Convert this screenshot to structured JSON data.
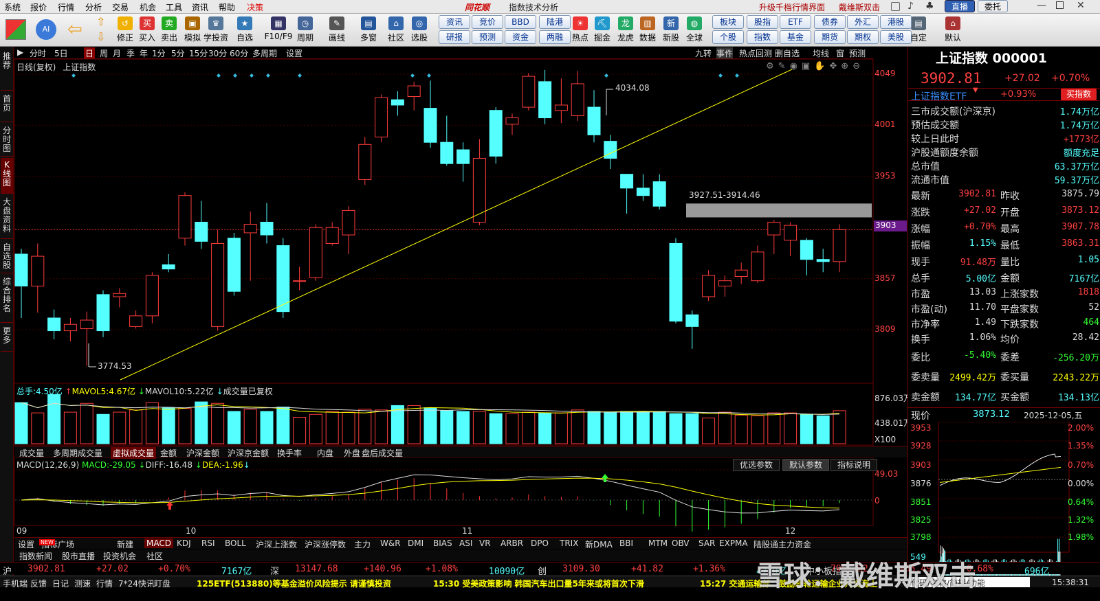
{
  "menu": [
    "系统",
    "报价",
    "行情",
    "分析",
    "交易",
    "机会",
    "工具",
    "资讯",
    "帮助",
    "决策"
  ],
  "brand": "同花顺",
  "window_title": "指数技术分析",
  "header_links": [
    "升级千档行情界面",
    "戴维斯双击"
  ],
  "header_buttons": [
    "直播",
    "委托"
  ],
  "toolbar": [
    "修正",
    "买入",
    "卖出",
    "模拟",
    "学投资",
    "自选",
    "F10/F9",
    "周期",
    "画线",
    "多窗",
    "社区",
    "选股",
    "热点",
    "掘金",
    "龙虎",
    "数据",
    "新股",
    "全球",
    "自定",
    "默认"
  ],
  "quick_top": [
    "资讯",
    "竞价",
    "BBD",
    "陆港",
    "板块",
    "股指",
    "ETF",
    "债券",
    "外汇",
    "港股"
  ],
  "quick_bot": [
    "研报",
    "预测",
    "资金",
    "两融",
    "个股",
    "指数",
    "基金",
    "期货",
    "期权",
    "美股"
  ],
  "left_tabs": [
    "推荐",
    "首页",
    "分时图",
    "K线图",
    "大盘资料",
    "自选股",
    "综合排名",
    "更多"
  ],
  "timeframes": [
    "分时",
    "5日",
    "日",
    "周",
    "月",
    "季",
    "年",
    "1分",
    "5分",
    "15分",
    "30分",
    "60分",
    "多周期",
    "设置"
  ],
  "tf_right": [
    "九转",
    "事件",
    "热点回测",
    "删自选",
    "均线",
    "窗",
    "预测"
  ],
  "chart_header": {
    "mode": "日线(复权)",
    "name": "上证指数"
  },
  "price_axis": [
    "4049",
    "4001",
    "3953",
    "3903",
    "3857",
    "3809"
  ],
  "current_price_tag": "3903",
  "annotations": {
    "high": "4034.08",
    "low": "3774.53",
    "gap": "3927.51-3914.46"
  },
  "volume": {
    "label": "总手:",
    "total": "4.50亿",
    "mavol5_label": "MAVOL5:",
    "mavol5": "4.67亿",
    "mavol10_label": "MAVOL10:",
    "mavol10": "5.22亿",
    "note": "成交量已复权",
    "axis": [
      "876.03万",
      "438.01万",
      "X100"
    ]
  },
  "vol_tabs": [
    "成交量",
    "多周期成交量",
    "虚拟成交量",
    "金额",
    "沪深金额",
    "沪深京金额",
    "换手率",
    "内盘",
    "外盘",
    "盘后成交量"
  ],
  "macd": {
    "title": "MACD(12,26,9)",
    "macd_label": "MACD:",
    "macd": "-29.05",
    "diff_label": "DIFF:",
    "diff": "-16.48",
    "dea_label": "DEA:",
    "dea": "-1.96",
    "axis": [
      "49.03",
      "0"
    ],
    "buttons": [
      "优选参数",
      "默认参数",
      "指标说明"
    ]
  },
  "x_axis": [
    "09",
    "10",
    "11",
    "12"
  ],
  "ind_tabs": [
    "设置",
    "指标广场",
    "新建",
    "MACD",
    "KDJ",
    "RSI",
    "BOLL",
    "沪深上涨数",
    "沪深涨停数",
    "主力",
    "W&R",
    "DMI",
    "BIAS",
    "ASI",
    "VR",
    "ARBR",
    "DPO",
    "TRIX",
    "新DMA",
    "BBI",
    "MTM",
    "OBV",
    "SAR",
    "EXPMA",
    "陆股通主力资金"
  ],
  "ind_tabs2": [
    "指数新闻",
    "股市直播",
    "投资机会",
    "社区"
  ],
  "quote": {
    "title": "上证指数",
    "code": "000001",
    "price": "3902.81",
    "change": "+27.02",
    "pct": "+0.70%",
    "etf": "上证指数ETF",
    "etf_pct": "+0.93%",
    "buy_btn": "买指数"
  },
  "stats1": [
    [
      "三市成交额(沪深京)",
      "1.74万亿"
    ],
    [
      "预估成交额",
      "1.74万亿"
    ],
    [
      "较上日此时",
      "+1773亿"
    ],
    [
      "沪股通额度余额",
      "额度充足"
    ],
    [
      "总市值",
      "63.37万亿"
    ],
    [
      "流通市值",
      "59.37万亿"
    ]
  ],
  "stats2": [
    [
      "最新",
      "3902.81",
      "昨收",
      "3875.79"
    ],
    [
      "涨跌",
      "+27.02",
      "开盘",
      "3873.12"
    ],
    [
      "涨幅",
      "+0.70%",
      "最高",
      "3907.78"
    ],
    [
      "振幅",
      "1.15%",
      "最低",
      "3863.31"
    ],
    [
      "现手",
      "91.48万",
      "量比",
      "1.05"
    ],
    [
      "总手",
      "5.00亿",
      "金额",
      "7167亿"
    ]
  ],
  "stats3": [
    [
      "市盈",
      "13.03",
      "上涨家数",
      "1818"
    ],
    [
      "市盈(动)",
      "11.70",
      "平盘家数",
      "52"
    ],
    [
      "市净率",
      "1.49",
      "下跌家数",
      "464"
    ],
    [
      "换手",
      "1.06%",
      "均价",
      "28.42"
    ]
  ],
  "stats4": [
    [
      "委比",
      "-5.40%",
      "委差",
      "-256.20万"
    ],
    [
      "委卖量",
      "2499.42万",
      "委买量",
      "2243.22万"
    ],
    [
      "卖金额",
      "134.77亿",
      "买金额",
      "134.13亿"
    ]
  ],
  "mini": {
    "label": "现价",
    "price": "3873.12",
    "date": "2025-12-05,五",
    "left_axis": [
      "3953",
      "3928",
      "3903",
      "3876",
      "3851",
      "3825",
      "3798",
      "549"
    ],
    "right_axis": [
      "2.00%",
      "1.35%",
      "0.70%",
      "0.00%",
      "0.64%",
      "1.32%",
      "1.98%"
    ]
  },
  "quotes_bar": [
    [
      "沪",
      "3902.81",
      "+27.02",
      "+0.70%",
      "7167亿"
    ],
    [
      "深",
      "13147.68",
      "+140.96",
      "+1.08%",
      "10090亿"
    ],
    [
      "创",
      "3109.30",
      "+41.82",
      "+1.36%",
      "4770亿"
    ],
    [
      "中小板指",
      "7957.82",
      "+53.49",
      "+0.68%",
      "696亿"
    ]
  ],
  "status": {
    "tabs": [
      "手机端",
      "反馈",
      "日记",
      "测速",
      "行情",
      "7*24快讯",
      "盯盘"
    ],
    "news1": "125ETF(513880)等基金溢价风险提示 请谨慎投资",
    "news2": "15:30 受美政策影响 韩国汽车出口量5年来或将首次下滑",
    "news3": "15:27 交通运输部：鼓励邮轮运输企业开发海上",
    "search": "代码/名称/简拼/功能",
    "time": "15:38:31"
  },
  "watermark": "雪球：戴维斯双击",
  "candles": [
    [
      3880,
      3850,
      3885,
      3820
    ],
    [
      3850,
      3878,
      3890,
      3825
    ],
    [
      3820,
      3808,
      3828,
      3800
    ],
    [
      3808,
      3814,
      3820,
      3798
    ],
    [
      3810,
      3818,
      3826,
      3775
    ],
    [
      3842,
      3808,
      3846,
      3802
    ],
    [
      3840,
      3843,
      3848,
      3830
    ],
    [
      3812,
      3822,
      3827,
      3810
    ],
    [
      3822,
      3860,
      3863,
      3815
    ],
    [
      3870,
      3866,
      3880,
      3863
    ],
    [
      3895,
      3935,
      3938,
      3888
    ],
    [
      3910,
      3892,
      3930,
      3885
    ],
    [
      3812,
      3890,
      3903,
      3808
    ],
    [
      3895,
      3845,
      3900,
      3841
    ],
    [
      3900,
      3908,
      3920,
      3855
    ],
    [
      3910,
      3898,
      3928,
      3890
    ],
    [
      3888,
      3826,
      3895,
      3820
    ],
    [
      3855,
      3855,
      3868,
      3846
    ],
    [
      3858,
      3905,
      3908,
      3855
    ],
    [
      3890,
      3905,
      3910,
      3888
    ],
    [
      3898,
      3921,
      3925,
      3880
    ],
    [
      3950,
      3983,
      3990,
      3945
    ],
    [
      3990,
      4027,
      4030,
      3985
    ],
    [
      4025,
      4020,
      4033,
      4010
    ],
    [
      4028,
      4038,
      4042,
      4015
    ],
    [
      4017,
      3985,
      4043,
      3980
    ],
    [
      3985,
      3965,
      4010,
      3963
    ],
    [
      3978,
      3965,
      3985,
      3948
    ],
    [
      3910,
      3970,
      3988,
      3907
    ],
    [
      4015,
      3972,
      4018,
      3965
    ],
    [
      4002,
      4008,
      4012,
      3992
    ],
    [
      4018,
      4047,
      4050,
      4015
    ],
    [
      4042,
      4008,
      4053,
      4002
    ],
    [
      4015,
      4020,
      4045,
      4003
    ],
    [
      4010,
      4040,
      4052,
      4005
    ],
    [
      4018,
      3992,
      4034,
      3985
    ],
    [
      3986,
      3970,
      3992,
      3960
    ],
    [
      3955,
      3942,
      3955,
      3918
    ],
    [
      3942,
      3935,
      3955,
      3930
    ],
    [
      3948,
      3925,
      3955,
      3922
    ],
    [
      3890,
      3817,
      3895,
      3815
    ],
    [
      3823,
      3812,
      3827,
      3791
    ],
    [
      3840,
      3860,
      3865,
      3836
    ],
    [
      3850,
      3855,
      3860,
      3840
    ],
    [
      3859,
      3865,
      3872,
      3852
    ],
    [
      3855,
      3882,
      3888,
      3853
    ],
    [
      3898,
      3910,
      3912,
      3880
    ],
    [
      3893,
      3907,
      3910,
      3878
    ],
    [
      3893,
      3875,
      3895,
      3860
    ],
    [
      3875,
      3873,
      3885,
      3863
    ],
    [
      3873,
      3903,
      3908,
      3863
    ]
  ],
  "volumes": [
    5.6,
    4.2,
    6.7,
    4.3,
    5.5,
    4.0,
    4.3,
    4.6,
    5.6,
    4.9,
    4.8,
    5.7,
    5.5,
    4.4,
    4.7,
    4.4,
    5.0,
    3.6,
    4.0,
    4.4,
    4.3,
    4.7,
    4.6,
    5.2,
    5.2,
    4.9,
    4.5,
    4.4,
    4.4,
    4.1,
    4.1,
    4.3,
    4.2,
    4.2,
    4.6,
    4.4,
    4.3,
    4.4,
    4.4,
    4.4,
    4.1,
    4.1,
    3.5,
    4.3,
    3.9,
    3.8,
    4.2,
    4.2,
    4.0,
    3.8,
    4.5
  ]
}
